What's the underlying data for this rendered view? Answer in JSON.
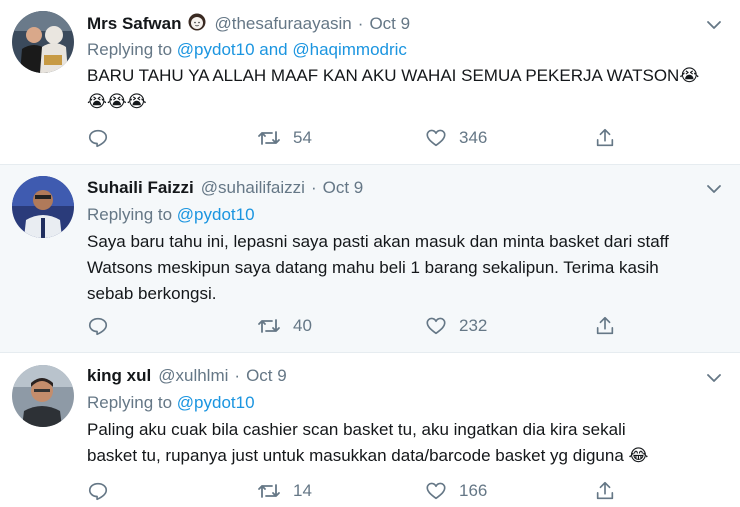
{
  "tweets": [
    {
      "name": "Mrs Safwan",
      "name_badge_icon": "woman-emoji-icon",
      "handle": "@thesafuraayasin",
      "dot": "·",
      "time": "Oct 9",
      "replying_prefix": "Replying to",
      "replying_to": "@pydot10 and @haqimmodric",
      "lines": [
        "BARU TAHU YA ALLAH MAAF KAN AKU WAHAI SEMUA PEKERJA WATSON😭",
        "😭😭😭"
      ],
      "reply_count": "",
      "retweet_count": "54",
      "like_count": "346"
    },
    {
      "name": "Suhaili Faizzi",
      "handle": "@suhailifaizzi",
      "dot": "·",
      "time": "Oct 9",
      "replying_prefix": "Replying to",
      "replying_to": "@pydot10",
      "lines": [
        "Saya baru tahu ini, lepasni saya pasti akan masuk dan minta basket dari staff",
        "Watsons meskipun saya datang mahu beli 1 barang sekalipun. Terima kasih",
        "sebab berkongsi."
      ],
      "reply_count": "",
      "retweet_count": "40",
      "like_count": "232"
    },
    {
      "name": "king xul",
      "handle": "@xulhlmi",
      "dot": "·",
      "time": "Oct 9",
      "replying_prefix": "Replying to",
      "replying_to": "@pydot10",
      "lines": [
        "Paling aku cuak bila cashier scan basket tu, aku ingatkan dia kira sekali",
        "basket tu, rupanya just untuk masukkan data/barcode basket yg diguna 😂"
      ],
      "reply_count": "",
      "retweet_count": "14",
      "like_count": "166"
    }
  ],
  "icons": {
    "reply": "reply-icon",
    "retweet": "retweet-icon",
    "like": "heart-icon",
    "share": "share-icon",
    "more": "chevron-down-icon"
  },
  "colors": {
    "link": "#1b95e0",
    "secondary": "#657786",
    "text": "#14171a",
    "hover_bg": "#f5f8fa",
    "divider": "#e6ecf0"
  }
}
